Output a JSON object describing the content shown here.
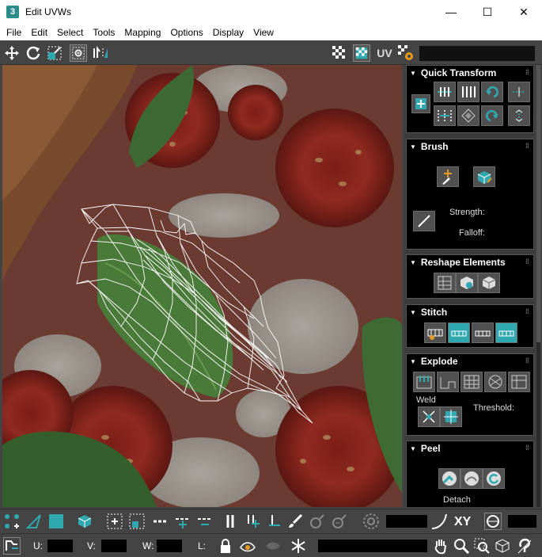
{
  "window": {
    "title": "Edit UVWs",
    "app_icon": "3",
    "min_glyph": "—",
    "max_glyph": "☐",
    "close_glyph": "✕"
  },
  "menubar": {
    "items": [
      "File",
      "Edit",
      "Select",
      "Tools",
      "Mapping",
      "Options",
      "Display",
      "View"
    ]
  },
  "toolbar": {
    "uv_label": "UV"
  },
  "panel": {
    "quick_transform": "Quick Transform",
    "brush": "Brush",
    "brush_strength": "Strength:",
    "brush_falloff": "Falloff:",
    "reshape": "Reshape Elements",
    "stitch": "Stitch",
    "explode": "Explode",
    "weld": "Weld",
    "threshold": "Threshold:",
    "peel": "Peel",
    "detach": "Detach"
  },
  "status": {
    "xy_label": "XY",
    "u_label": "U:",
    "v_label": "V:",
    "w_label": "W:",
    "l_label": "L:"
  },
  "colors": {
    "accent": "#2fa8b0",
    "rollout_bg": "#000000",
    "panel_bg": "#3c3c3c",
    "toolbar_bg": "#444444"
  }
}
